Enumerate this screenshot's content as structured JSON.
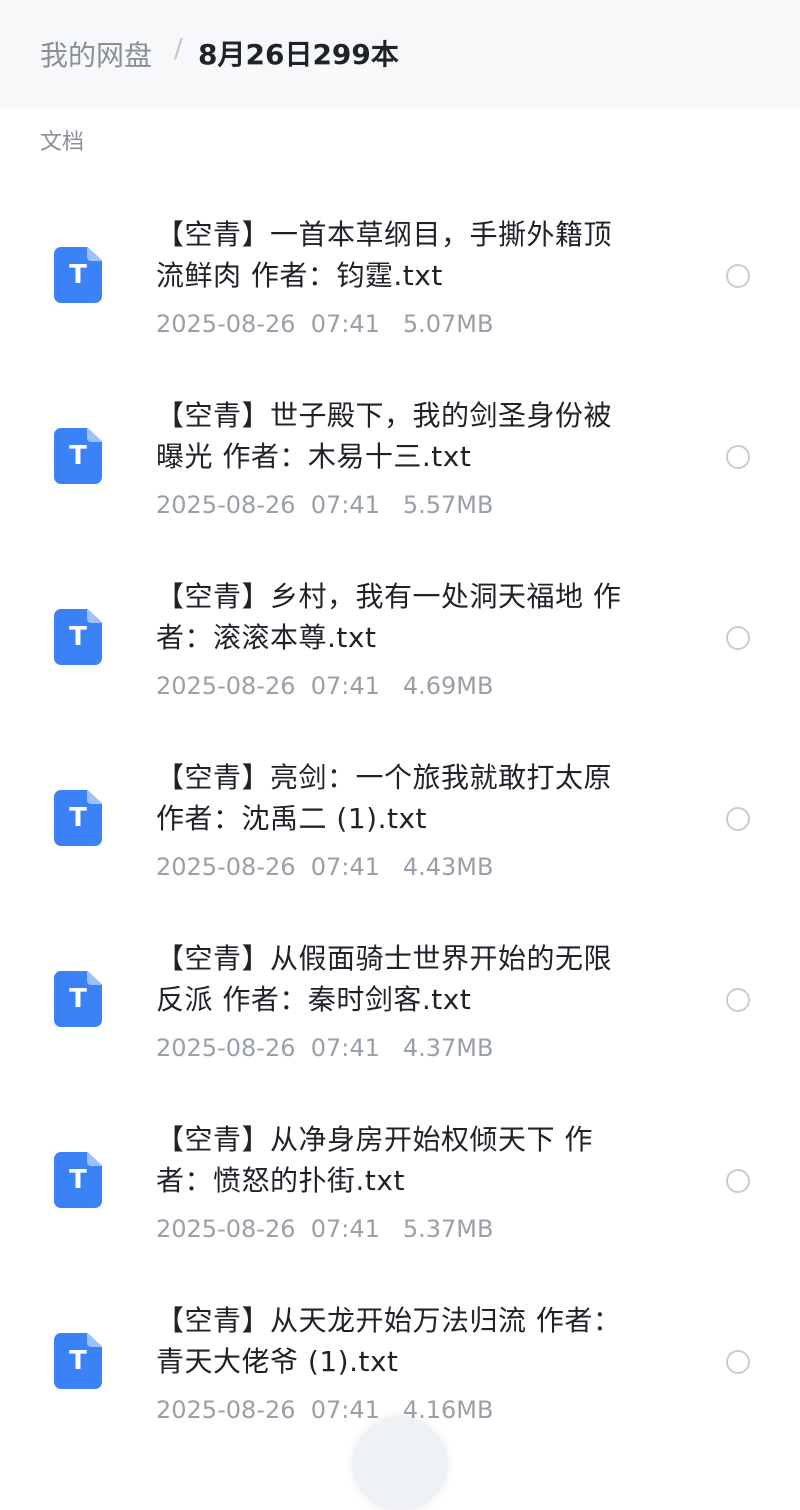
{
  "breadcrumb": {
    "root": "我的网盘",
    "separator": "/",
    "current": "8月26日299本"
  },
  "section_label": "文档",
  "files": [
    {
      "icon": "txt-file-icon",
      "icon_letter": "T",
      "name_line1": "【空青】一首本草纲目，手撕外籍顶",
      "name_line2": "流鲜肉 作者：钧霆.txt",
      "date": "2025-08-26",
      "time": "07:41",
      "size": "5.07MB"
    },
    {
      "icon": "txt-file-icon",
      "icon_letter": "T",
      "name_line1": "【空青】世子殿下，我的剑圣身份被",
      "name_line2": "曝光 作者：木易十三.txt",
      "date": "2025-08-26",
      "time": "07:41",
      "size": "5.57MB"
    },
    {
      "icon": "txt-file-icon",
      "icon_letter": "T",
      "name_line1": "【空青】乡村，我有一处洞天福地 作",
      "name_line2": "者：滚滚本尊.txt",
      "date": "2025-08-26",
      "time": "07:41",
      "size": "4.69MB"
    },
    {
      "icon": "txt-file-icon",
      "icon_letter": "T",
      "name_line1": "【空青】亮剑：一个旅我就敢打太原",
      "name_line2": "作者：沈禹二 (1).txt",
      "date": "2025-08-26",
      "time": "07:41",
      "size": "4.43MB"
    },
    {
      "icon": "txt-file-icon",
      "icon_letter": "T",
      "name_line1": "【空青】从假面骑士世界开始的无限",
      "name_line2": "反派 作者：秦时剑客.txt",
      "date": "2025-08-26",
      "time": "07:41",
      "size": "4.37MB"
    },
    {
      "icon": "txt-file-icon",
      "icon_letter": "T",
      "name_line1": "【空青】从净身房开始权倾天下 作",
      "name_line2": "者：愤怒的扑街.txt",
      "date": "2025-08-26",
      "time": "07:41",
      "size": "5.37MB"
    },
    {
      "icon": "txt-file-icon",
      "icon_letter": "T",
      "name_line1": "【空青】从天龙开始万法归流 作者：",
      "name_line2": "青天大佬爷 (1).txt",
      "date": "2025-08-26",
      "time": "07:41",
      "size": "4.16MB"
    }
  ],
  "colors": {
    "accent": "#3b82f6",
    "text_primary": "#1f2329",
    "text_secondary": "#9aa0a8"
  }
}
